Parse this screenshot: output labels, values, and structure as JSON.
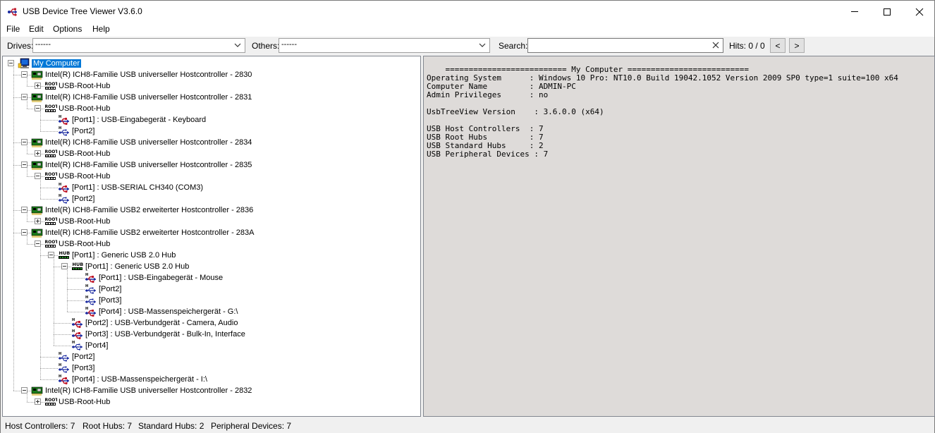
{
  "window": {
    "title": "USB Device Tree Viewer V3.6.0"
  },
  "menu": [
    "File",
    "Edit",
    "Options",
    "Help"
  ],
  "toolbar": {
    "drives_label": "Drives:",
    "drives_value": "------",
    "others_label": "Others:",
    "others_value": "------",
    "search_label": "Search:",
    "search_value": "",
    "hits_label": "Hits:  0 / 0",
    "prev_glyph": "<",
    "next_glyph": ">"
  },
  "tree": [
    {
      "label": "My Computer",
      "icon": "computer-icon",
      "depth": 0,
      "expanded": true,
      "selected": true
    },
    {
      "label": "Intel(R) ICH8-Familie USB universeller Hostcontroller - 2830",
      "icon": "hostcontroller-icon",
      "depth": 1,
      "expanded": true
    },
    {
      "label": "USB-Root-Hub",
      "icon": "root-hub-icon",
      "depth": 2,
      "expanded": false
    },
    {
      "label": "Intel(R) ICH8-Familie USB universeller Hostcontroller - 2831",
      "icon": "hostcontroller-icon",
      "depth": 1,
      "expanded": true
    },
    {
      "label": "USB-Root-Hub",
      "icon": "root-hub-icon",
      "depth": 2,
      "expanded": true
    },
    {
      "label": "[Port1] : USB-Eingabegerät - Keyboard",
      "icon": "usb-device-icon",
      "depth": 3
    },
    {
      "label": "[Port2]",
      "icon": "usb-port-icon",
      "depth": 3
    },
    {
      "label": "Intel(R) ICH8-Familie USB universeller Hostcontroller - 2834",
      "icon": "hostcontroller-icon",
      "depth": 1,
      "expanded": true
    },
    {
      "label": "USB-Root-Hub",
      "icon": "root-hub-icon",
      "depth": 2,
      "expanded": false
    },
    {
      "label": "Intel(R) ICH8-Familie USB universeller Hostcontroller - 2835",
      "icon": "hostcontroller-icon",
      "depth": 1,
      "expanded": true
    },
    {
      "label": "USB-Root-Hub",
      "icon": "root-hub-icon",
      "depth": 2,
      "expanded": true
    },
    {
      "label": "[Port1] : USB-SERIAL CH340 (COM3)",
      "icon": "usb-device-icon",
      "depth": 3
    },
    {
      "label": "[Port2]",
      "icon": "usb-port-icon",
      "depth": 3
    },
    {
      "label": "Intel(R) ICH8-Familie USB2 erweiterter Hostcontroller - 2836",
      "icon": "hostcontroller-icon",
      "depth": 1,
      "expanded": true
    },
    {
      "label": "USB-Root-Hub",
      "icon": "root-hub-icon",
      "depth": 2,
      "expanded": false
    },
    {
      "label": "Intel(R) ICH8-Familie USB2 erweiterter Hostcontroller - 283A",
      "icon": "hostcontroller-icon",
      "depth": 1,
      "expanded": true
    },
    {
      "label": "USB-Root-Hub",
      "icon": "root-hub-icon",
      "depth": 2,
      "expanded": true
    },
    {
      "label": "[Port1] : Generic USB 2.0 Hub",
      "icon": "hub-icon",
      "depth": 3,
      "expanded": true
    },
    {
      "label": "[Port1] : Generic USB 2.0 Hub",
      "icon": "hub-icon",
      "depth": 4,
      "expanded": true
    },
    {
      "label": "[Port1] : USB-Eingabegerät - Mouse",
      "icon": "usb-device-icon",
      "depth": 5
    },
    {
      "label": "[Port2]",
      "icon": "usb-port-icon",
      "depth": 5
    },
    {
      "label": "[Port3]",
      "icon": "usb-port-icon",
      "depth": 5
    },
    {
      "label": "[Port4] : USB-Massenspeichergerät - G:\\",
      "icon": "usb-device-icon",
      "depth": 5
    },
    {
      "label": "[Port2] : USB-Verbundgerät - Camera, Audio",
      "icon": "usb-device-icon",
      "depth": 4
    },
    {
      "label": "[Port3] : USB-Verbundgerät - Bulk-In, Interface",
      "icon": "usb-device-icon",
      "depth": 4
    },
    {
      "label": "[Port4]",
      "icon": "usb-port-icon",
      "depth": 4
    },
    {
      "label": "[Port2]",
      "icon": "usb-port-icon",
      "depth": 3
    },
    {
      "label": "[Port3]",
      "icon": "usb-port-icon",
      "depth": 3
    },
    {
      "label": "[Port4] : USB-Massenspeichergerät - I:\\",
      "icon": "usb-device-icon",
      "depth": 3
    },
    {
      "label": "Intel(R) ICH8-Familie USB universeller Hostcontroller - 2832",
      "icon": "hostcontroller-icon",
      "depth": 1,
      "expanded": true
    },
    {
      "label": "USB-Root-Hub",
      "icon": "root-hub-icon",
      "depth": 2,
      "expanded": false
    }
  ],
  "info": [
    "    ========================== My Computer ==========================",
    "Operating System      : Windows 10 Pro: NT10.0 Build 19042.1052 Version 2009 SP0 type=1 suite=100 x64",
    "Computer Name         : ADMIN-PC",
    "Admin Privileges      : no",
    "",
    "UsbTreeView Version    : 3.6.0.0 (x64)",
    "",
    "USB Host Controllers  : 7",
    "USB Root Hubs         : 7",
    "USB Standard Hubs     : 2",
    "USB Peripheral Devices : 7"
  ],
  "status": {
    "host_controllers": "Host Controllers: 7",
    "root_hubs": "Root Hubs: 7",
    "standard_hubs": "Standard Hubs: 2",
    "peripheral_devices": "Peripheral Devices: 7"
  }
}
